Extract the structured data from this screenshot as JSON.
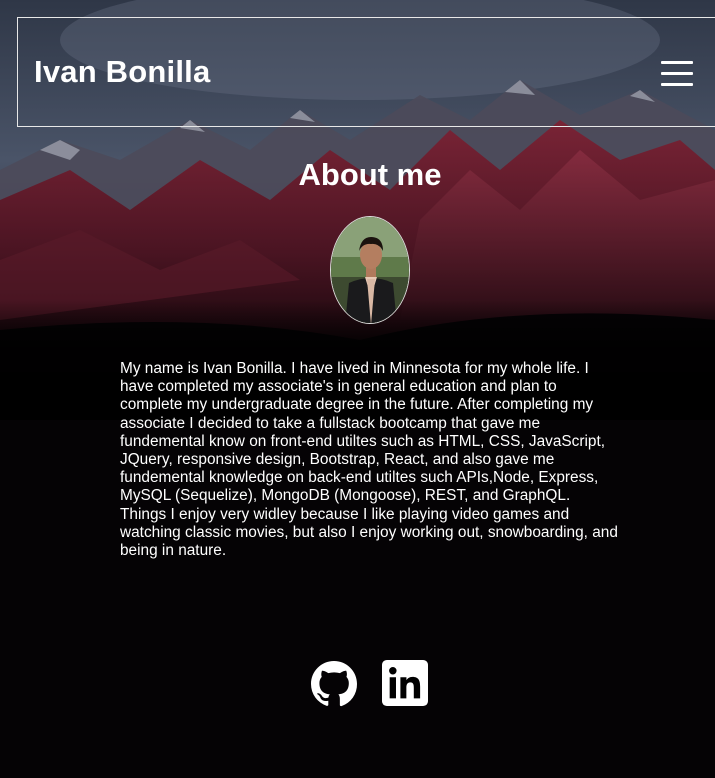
{
  "header": {
    "brand": "Ivan Bonilla",
    "menu_icon": "hamburger-menu-icon"
  },
  "about": {
    "title": "About me",
    "photo_icon": "profile-photo",
    "bio": "My name is Ivan Bonilla. I have lived in Minnesota for my whole life. I have completed my associate's in general education and plan to complete my undergraduate degree in the future. After completing my associate I decided to take a fullstack bootcamp that gave me fundemental know on front-end utiltes such as HTML, CSS, JavaScript, JQuery, responsive design, Bootstrap, React, and also gave me fundemental knowledge on back-end utiltes such APIs,Node, Express, MySQL (Sequelize), MongoDB (Mongoose), REST, and GraphQL. Things I enjoy very widley because I like playing video games and watching classic movies, but also I enjoy working out, snowboarding, and being in nature."
  },
  "socials": [
    {
      "icon": "github-icon"
    },
    {
      "icon": "linkedin-icon"
    }
  ],
  "colors": {
    "text": "#ffffff",
    "background": "#000000",
    "mountain_red": "#6b1d2e",
    "sky": "#3a4456"
  }
}
